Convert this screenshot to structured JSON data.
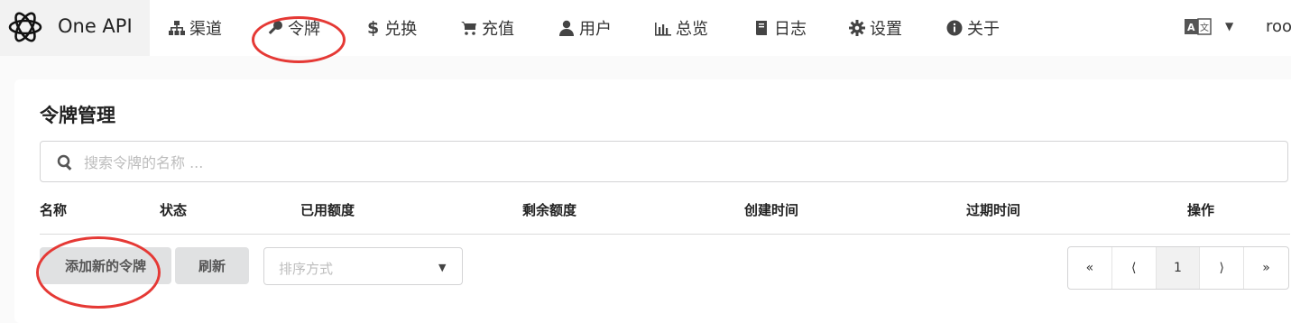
{
  "brand": {
    "name": "One API",
    "icon": "openai-logo-icon"
  },
  "nav": [
    {
      "label": "渠道",
      "icon": "sitemap-icon"
    },
    {
      "label": "令牌",
      "icon": "key-icon"
    },
    {
      "label": "兑换",
      "icon": "dollar-icon"
    },
    {
      "label": "充值",
      "icon": "cart-icon"
    },
    {
      "label": "用户",
      "icon": "user-icon"
    },
    {
      "label": "总览",
      "icon": "bar-chart-icon"
    },
    {
      "label": "日志",
      "icon": "book-icon"
    },
    {
      "label": "设置",
      "icon": "gear-icon"
    },
    {
      "label": "关于",
      "icon": "info-icon"
    }
  ],
  "header_right": {
    "language_icon": "translate-icon",
    "user": "roo"
  },
  "page": {
    "title": "令牌管理",
    "search_placeholder": "搜索令牌的名称 ...",
    "columns": [
      "名称",
      "状态",
      "已用额度",
      "剩余额度",
      "创建时间",
      "过期时间",
      "操作"
    ],
    "add_button": "添加新的令牌",
    "refresh_button": "刷新",
    "sort_placeholder": "排序方式",
    "pagination": {
      "first": "«",
      "prev": "⟨",
      "current": "1",
      "next": "⟩",
      "last": "»"
    }
  },
  "annotation_color": "#e53935"
}
